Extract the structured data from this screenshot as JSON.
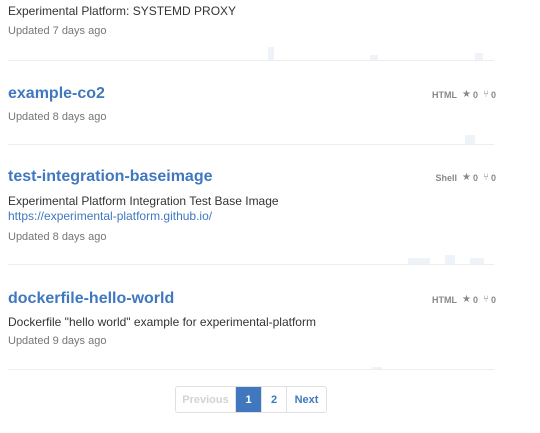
{
  "repos": [
    {
      "name": "",
      "description": "Experimental Platform: SYSTEMD PROXY",
      "updated": "Updated 7 days ago"
    },
    {
      "name": "example-co2",
      "description": "",
      "updated": "Updated 8 days ago",
      "language": "HTML",
      "stars": "0",
      "forks": "0"
    },
    {
      "name": "test-integration-baseimage",
      "description": "Experimental Platform Integration Test Base Image",
      "link_text": "https://experimental-platform.github.io/",
      "updated": "Updated 8 days ago",
      "language": "Shell",
      "stars": "0",
      "forks": "0"
    },
    {
      "name": "dockerfile-hello-world",
      "description": "Dockerfile \"hello world\" example for experimental-platform",
      "updated": "Updated 9 days ago",
      "language": "HTML",
      "stars": "0",
      "forks": "0"
    }
  ],
  "icons": {
    "star": "star-icon",
    "fork": "fork-icon"
  },
  "pagination": {
    "previous": "Previous",
    "pages": [
      "1",
      "2"
    ],
    "current": "1",
    "next": "Next"
  },
  "colors": {
    "link": "#4078c0",
    "muted": "#767676",
    "divider": "#eeeeee"
  }
}
